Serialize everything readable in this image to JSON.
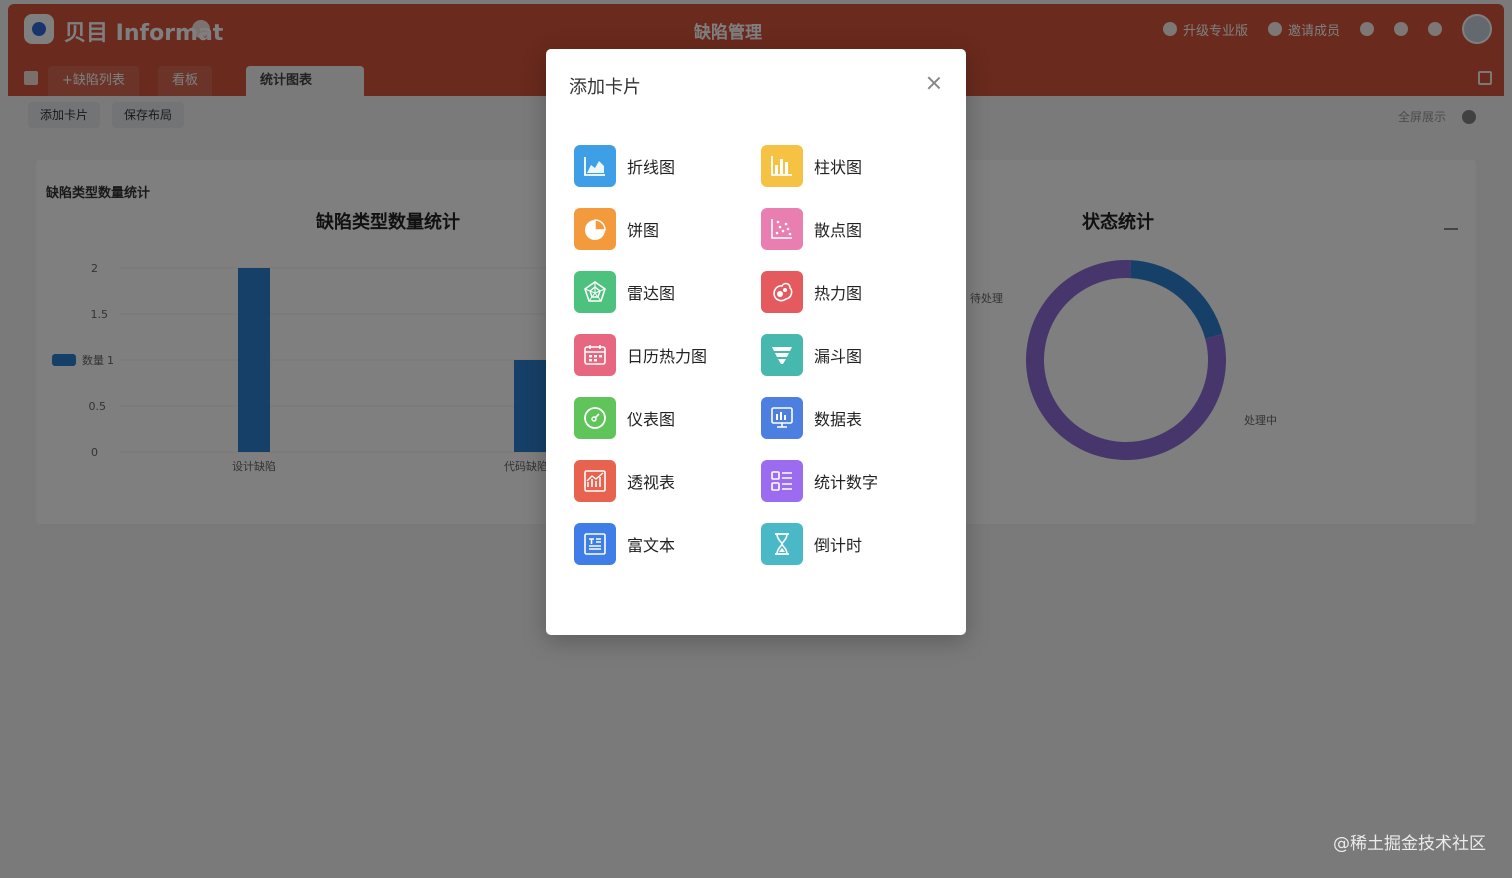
{
  "background": {
    "app_name": "贝目 Informat",
    "center_title": "缺陷管理",
    "top_right": [
      "升级专业版",
      "邀请成员"
    ],
    "tabs": [
      "+缺陷列表",
      "看板",
      "统计图表"
    ],
    "toolbar": [
      "添加卡片",
      "保存布局"
    ],
    "toolbar_right": "全屏展示",
    "panel_label": "缺陷类型数量统计",
    "chart_left_title": "缺陷类型数量统计",
    "chart_right_title": "状态统计",
    "legend_label": "数量",
    "y_ticks": [
      "2",
      "1.5",
      "1",
      "0.5",
      "0"
    ],
    "x_labels": [
      "设计缺陷",
      "代码缺陷"
    ],
    "donut_labels": [
      "待处理",
      "处理中"
    ]
  },
  "chart_data": [
    {
      "type": "bar",
      "title": "缺陷类型数量统计",
      "categories": [
        "设计缺陷",
        "代码缺陷"
      ],
      "series": [
        {
          "name": "数量",
          "values": [
            2,
            1
          ]
        }
      ],
      "ylim": [
        0,
        2
      ]
    },
    {
      "type": "pie",
      "title": "状态统计",
      "labels": [
        "待处理",
        "处理中"
      ],
      "values": [
        80,
        20
      ]
    }
  ],
  "modal": {
    "title": "添加卡片",
    "items": [
      {
        "label": "折线图",
        "icon": "line-chart-icon",
        "color": "#3f9fe6"
      },
      {
        "label": "柱状图",
        "icon": "bar-chart-icon",
        "color": "#f5c244"
      },
      {
        "label": "饼图",
        "icon": "pie-chart-icon",
        "color": "#f39a3c"
      },
      {
        "label": "散点图",
        "icon": "scatter-chart-icon",
        "color": "#e97fb0"
      },
      {
        "label": "雷达图",
        "icon": "radar-chart-icon",
        "color": "#4dc17e"
      },
      {
        "label": "热力图",
        "icon": "heatmap-icon",
        "color": "#e45a5f"
      },
      {
        "label": "日历热力图",
        "icon": "calendar-heatmap-icon",
        "color": "#e76781"
      },
      {
        "label": "漏斗图",
        "icon": "funnel-chart-icon",
        "color": "#47b8ad"
      },
      {
        "label": "仪表图",
        "icon": "gauge-icon",
        "color": "#5fc55b"
      },
      {
        "label": "数据表",
        "icon": "data-table-icon",
        "color": "#4d7fe0"
      },
      {
        "label": "透视表",
        "icon": "pivot-table-icon",
        "color": "#e7634f"
      },
      {
        "label": "统计数字",
        "icon": "statistic-number-icon",
        "color": "#9b6bf0"
      },
      {
        "label": "富文本",
        "icon": "rich-text-icon",
        "color": "#3f7ee8"
      },
      {
        "label": "倒计时",
        "icon": "countdown-icon",
        "color": "#4bb8c8"
      }
    ]
  },
  "watermark": "@稀土掘金技术社区"
}
